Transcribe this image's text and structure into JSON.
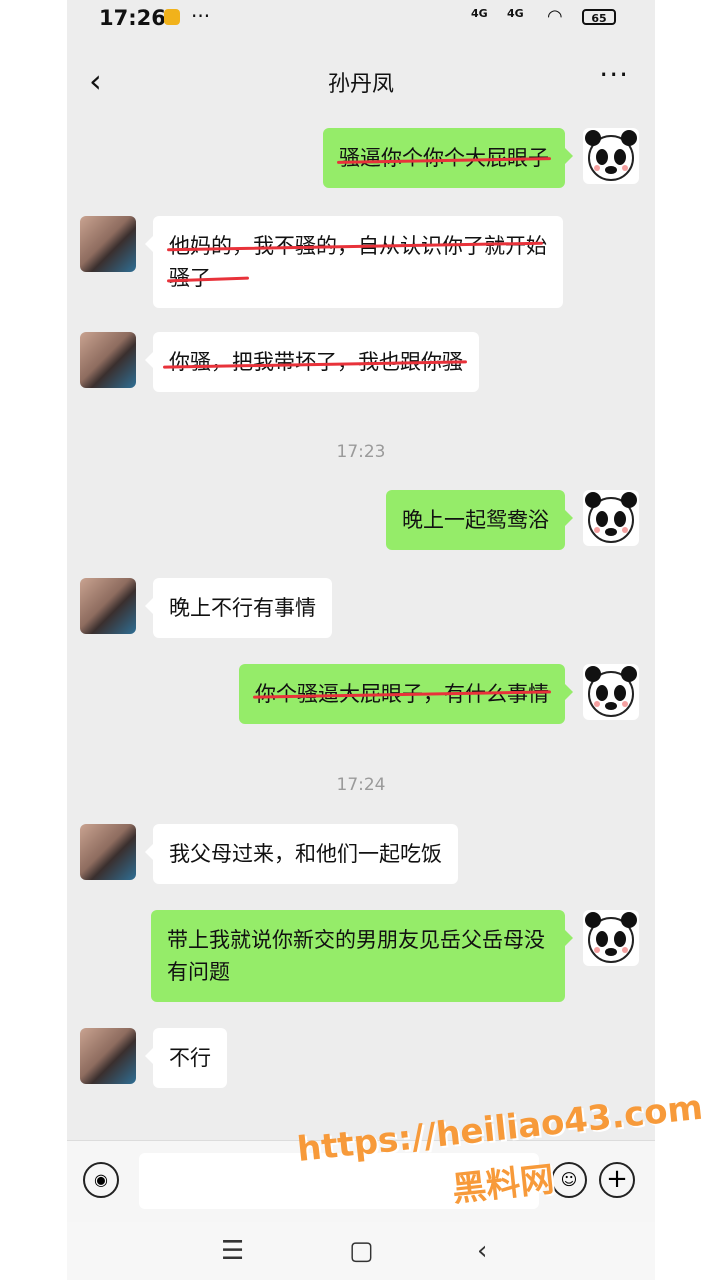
{
  "status": {
    "time": "17:26",
    "dots": "···",
    "net1": "4G",
    "net2": "4G",
    "battery": "65"
  },
  "header": {
    "back": "‹",
    "title": "孙丹凤",
    "more": "···"
  },
  "messages": [
    {
      "side": "right",
      "text": "骚逼你个你个大屁眼子",
      "struck": true
    },
    {
      "side": "left",
      "text": "他妈的，我不骚的，自从认识你了就开始骚了",
      "struck": true
    },
    {
      "side": "left",
      "text": "你骚，把我带坏了，我也跟你骚",
      "struck": true
    },
    {
      "side": "right",
      "text": "晚上一起鸳鸯浴",
      "struck": false
    },
    {
      "side": "left",
      "text": "晚上不行有事情",
      "struck": false
    },
    {
      "side": "right",
      "text": "你个骚逼大屁眼子，有什么事情",
      "struck": true
    },
    {
      "side": "left",
      "text": "我父母过来，和他们一起吃饭",
      "struck": false
    },
    {
      "side": "right",
      "text": "带上我就说你新交的男朋友见岳父岳母没有问题",
      "struck": false
    },
    {
      "side": "left",
      "text": "不行",
      "struck": false
    }
  ],
  "timestamps": [
    "17:23",
    "17:24"
  ],
  "input": {
    "placeholder": ""
  },
  "watermark": {
    "line1": "https://heiliao43.com",
    "line2": "黑料网"
  },
  "colors": {
    "bg": "#ededed",
    "sent_bubble": "#95ec69",
    "received_bubble": "#ffffff",
    "strike": "#e8323a",
    "watermark": "#f79a3a"
  },
  "icons": [
    "back-icon",
    "more-icon",
    "voice-icon",
    "emoji-icon",
    "plus-icon",
    "menu-icon",
    "home-icon",
    "back-nav-icon"
  ]
}
